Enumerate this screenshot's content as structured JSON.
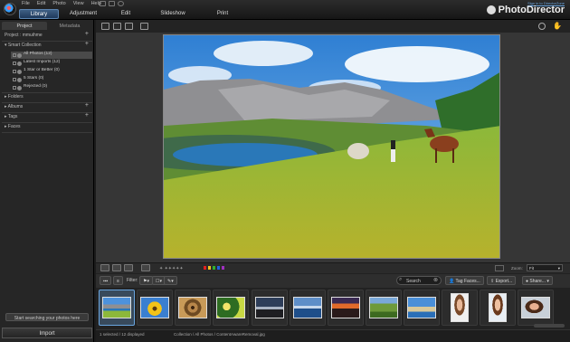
{
  "menu": [
    "File",
    "Edit",
    "Photo",
    "View",
    "Help"
  ],
  "main_tabs": [
    "Library",
    "Adjustment",
    "Edit",
    "Slideshow",
    "Print"
  ],
  "active_main_tab": "Library",
  "brand": "PhotoDirector",
  "sign_in": "Sign in to DirectorZone",
  "left": {
    "tabs": [
      "Project",
      "Metadata"
    ],
    "project_title": "Project : mmuihme",
    "smart_collection": "Smart Collection",
    "collection_items": [
      "All Photos (12)",
      "Latest Imports (12)",
      "1 Star or Better (0)",
      "5 Stars (0)",
      "Rejected (0)"
    ],
    "sections": [
      "Folders",
      "Albums",
      "Tags",
      "Faces"
    ],
    "search_button": "Start searching your photos here",
    "import_button": "Import"
  },
  "viewbar": {
    "zoom_label": "Zoom:",
    "zoom_value": "Fit",
    "color_labels": [
      "#e02020",
      "#f0c020",
      "#30b030",
      "#2060e0",
      "#a030c0"
    ]
  },
  "filterbar": {
    "filter_label": "Filter:",
    "search_placeholder": "Search",
    "tag_faces": "Tag Faces...",
    "export": "Export...",
    "share": "Share..."
  },
  "thumbnails": [
    {
      "name": "mountain-lake-horse",
      "selected": true
    },
    {
      "name": "sunflower",
      "selected": false
    },
    {
      "name": "spiral-shell",
      "selected": false
    },
    {
      "name": "flowers-macro",
      "selected": false
    },
    {
      "name": "dark-landscape",
      "selected": false
    },
    {
      "name": "coastline",
      "selected": false
    },
    {
      "name": "sunset",
      "selected": false
    },
    {
      "name": "green-field",
      "selected": false
    },
    {
      "name": "beach",
      "selected": false
    },
    {
      "name": "portrait-woman-1",
      "selected": false
    },
    {
      "name": "portrait-woman-2",
      "selected": false
    },
    {
      "name": "portrait-woman-3",
      "selected": false
    }
  ],
  "status": {
    "left": "1 selected / 12 displayed",
    "right": "Collection / All Photos / ContentAwareRemoval.jpg"
  }
}
